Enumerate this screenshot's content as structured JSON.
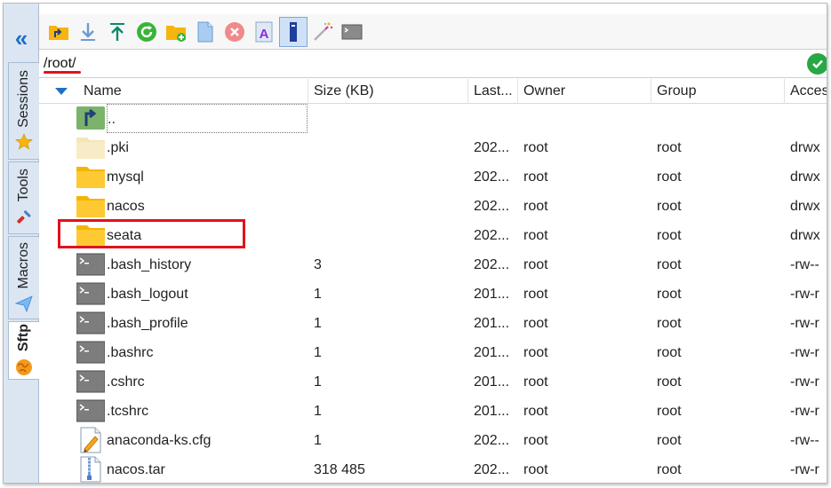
{
  "sidebar": {
    "tabs": [
      {
        "label": "Sessions",
        "icon": "star-icon"
      },
      {
        "label": "Tools",
        "icon": "tools-icon"
      },
      {
        "label": "Macros",
        "icon": "paper-plane-icon"
      },
      {
        "label": "Sftp",
        "icon": "globe-icon"
      }
    ]
  },
  "toolbar": {
    "buttons": [
      "parent-dir-icon",
      "download-icon",
      "upload-icon",
      "refresh-icon",
      "new-folder-icon",
      "new-file-icon",
      "delete-icon",
      "rename-icon",
      "text-mode-icon",
      "magic-wand-icon",
      "terminal-icon"
    ]
  },
  "path": {
    "value": "/root/"
  },
  "columns": {
    "name": "Name",
    "size": "Size (KB)",
    "last": "Last...",
    "owner": "Owner",
    "group": "Group",
    "perm": "Acces"
  },
  "files": [
    {
      "name": "..",
      "size": "",
      "last": "",
      "owner": "",
      "group": "",
      "perm": "",
      "icon": "parent-folder-icon"
    },
    {
      "name": ".pki",
      "size": "",
      "last": "202...",
      "owner": "root",
      "group": "root",
      "perm": "drwx",
      "icon": "folder-light-icon"
    },
    {
      "name": "mysql",
      "size": "",
      "last": "202...",
      "owner": "root",
      "group": "root",
      "perm": "drwx",
      "icon": "folder-icon"
    },
    {
      "name": "nacos",
      "size": "",
      "last": "202...",
      "owner": "root",
      "group": "root",
      "perm": "drwx",
      "icon": "folder-icon"
    },
    {
      "name": "seata",
      "size": "",
      "last": "202...",
      "owner": "root",
      "group": "root",
      "perm": "drwx",
      "icon": "folder-icon"
    },
    {
      "name": ".bash_history",
      "size": "3",
      "last": "202...",
      "owner": "root",
      "group": "root",
      "perm": "-rw--",
      "icon": "shell-file-icon"
    },
    {
      "name": ".bash_logout",
      "size": "1",
      "last": "201...",
      "owner": "root",
      "group": "root",
      "perm": "-rw-r",
      "icon": "shell-file-icon"
    },
    {
      "name": ".bash_profile",
      "size": "1",
      "last": "201...",
      "owner": "root",
      "group": "root",
      "perm": "-rw-r",
      "icon": "shell-file-icon"
    },
    {
      "name": ".bashrc",
      "size": "1",
      "last": "201...",
      "owner": "root",
      "group": "root",
      "perm": "-rw-r",
      "icon": "shell-file-icon"
    },
    {
      "name": ".cshrc",
      "size": "1",
      "last": "201...",
      "owner": "root",
      "group": "root",
      "perm": "-rw-r",
      "icon": "shell-file-icon"
    },
    {
      "name": ".tcshrc",
      "size": "1",
      "last": "201...",
      "owner": "root",
      "group": "root",
      "perm": "-rw-r",
      "icon": "shell-file-icon"
    },
    {
      "name": "anaconda-ks.cfg",
      "size": "1",
      "last": "202...",
      "owner": "root",
      "group": "root",
      "perm": "-rw--",
      "icon": "text-file-icon"
    },
    {
      "name": "nacos.tar",
      "size": "318 485",
      "last": "202...",
      "owner": "root",
      "group": "root",
      "perm": "-rw-r",
      "icon": "archive-file-icon"
    }
  ],
  "colors": {
    "accent": "#1f6fc4",
    "highlight": "#e0121c",
    "folder": "#ffc933",
    "ok": "#28a745"
  }
}
